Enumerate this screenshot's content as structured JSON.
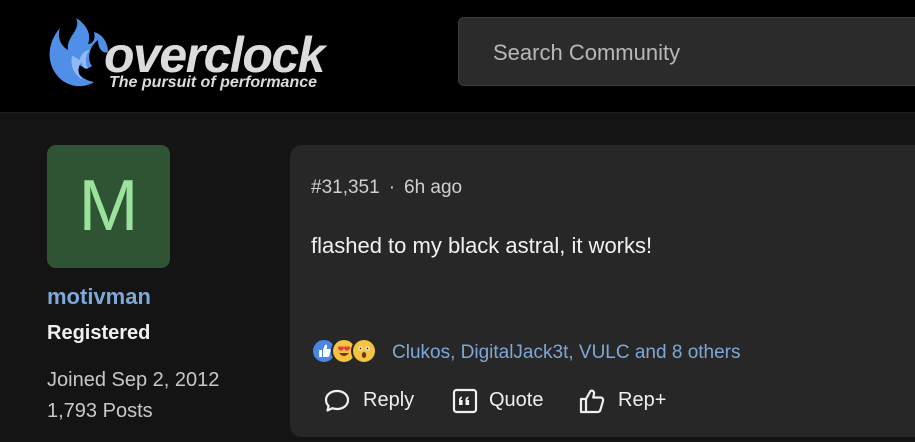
{
  "header": {
    "logo": {
      "name": "overclock",
      "tagline": "The pursuit of performance"
    },
    "search": {
      "placeholder": "Search Community"
    }
  },
  "author": {
    "avatar_letter": "M",
    "username": "motivman",
    "role": "Registered",
    "joined": "Joined Sep 2, 2012",
    "posts": "1,793 Posts"
  },
  "post": {
    "number": "#31,351",
    "separator": "·",
    "time_ago": "6h ago",
    "body": "flashed to my black astral, it works!",
    "reactions": {
      "icons": [
        "like-reaction-icon",
        "love-reaction-icon",
        "wow-reaction-icon"
      ],
      "text": "Clukos, DigitalJack3t, VULC and 8 others"
    },
    "actions": {
      "reply": "Reply",
      "quote": "Quote",
      "rep": "Rep+"
    }
  },
  "colors": {
    "accent_blue": "#7fa7d8",
    "avatar_bg": "#2f5433",
    "avatar_fg": "#9be29d",
    "card_bg": "#272727",
    "page_bg": "#141414"
  }
}
